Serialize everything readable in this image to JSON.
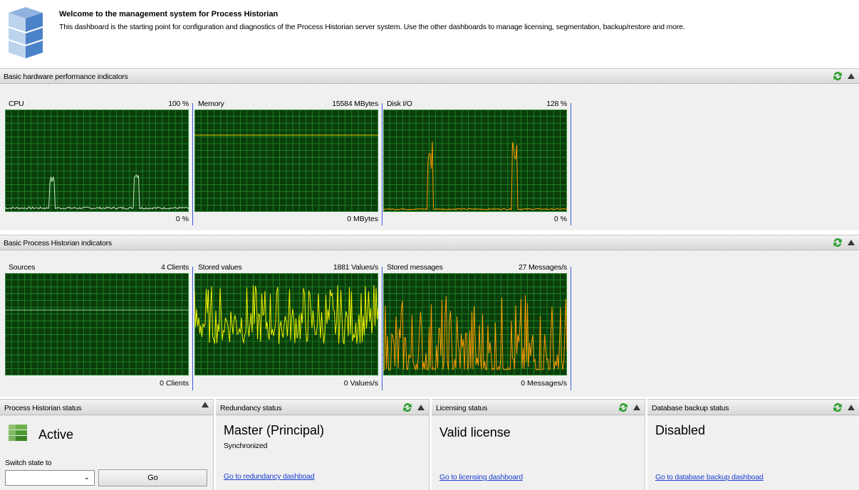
{
  "header": {
    "title": "Welcome to the management system for Process Historian",
    "description": "This dashboard is the starting point for configuration and diagnostics of the Process Historian server system. Use the other dashboards to manage licensing, segmentation, backup/restore and more."
  },
  "hardware": {
    "title": "Basic hardware performance indicators",
    "cpu": {
      "label": "CPU",
      "max": "100 %",
      "min": "0 %"
    },
    "memory": {
      "label": "Memory",
      "max": "15584 MBytes",
      "min": "0 MBytes"
    },
    "disk": {
      "label": "Disk I/O",
      "max": "128 %",
      "min": "0 %"
    }
  },
  "historian": {
    "title": "Basic Process Historian indicators",
    "sources": {
      "label": "Sources",
      "max": "4 Clients",
      "min": "0 Clients"
    },
    "stored_values": {
      "label": "Stored values",
      "max": "1881 Values/s",
      "min": "0 Values/s"
    },
    "stored_messages": {
      "label": "Stored messages",
      "max": "27 Messages/s",
      "min": "0 Messages/s"
    }
  },
  "status": {
    "ph": {
      "title": "Process Historian status",
      "state": "Active",
      "switch_label": "Switch state to",
      "go_label": "Go"
    },
    "redundancy": {
      "title": "Redundancy status",
      "state": "Master (Principal)",
      "sub": "Synchronized",
      "link": "Go to redundancy dashboad"
    },
    "licensing": {
      "title": "Licensing status",
      "state": "Valid license",
      "link": "Go to licensing dashboard"
    },
    "backup": {
      "title": "Database backup status",
      "state": "Disabled",
      "link": "Go to database backup dashboad"
    }
  },
  "colors": {
    "graph_bg": "#0b3d0b",
    "grid": "#1f8f2a",
    "cpu_line": "#c8f0c8",
    "memory_line": "#e8d000",
    "disk_line": "#ff9c00",
    "values_line": "#f0f000",
    "messages_line": "#ff9c00",
    "link": "#1a3fd0"
  }
}
